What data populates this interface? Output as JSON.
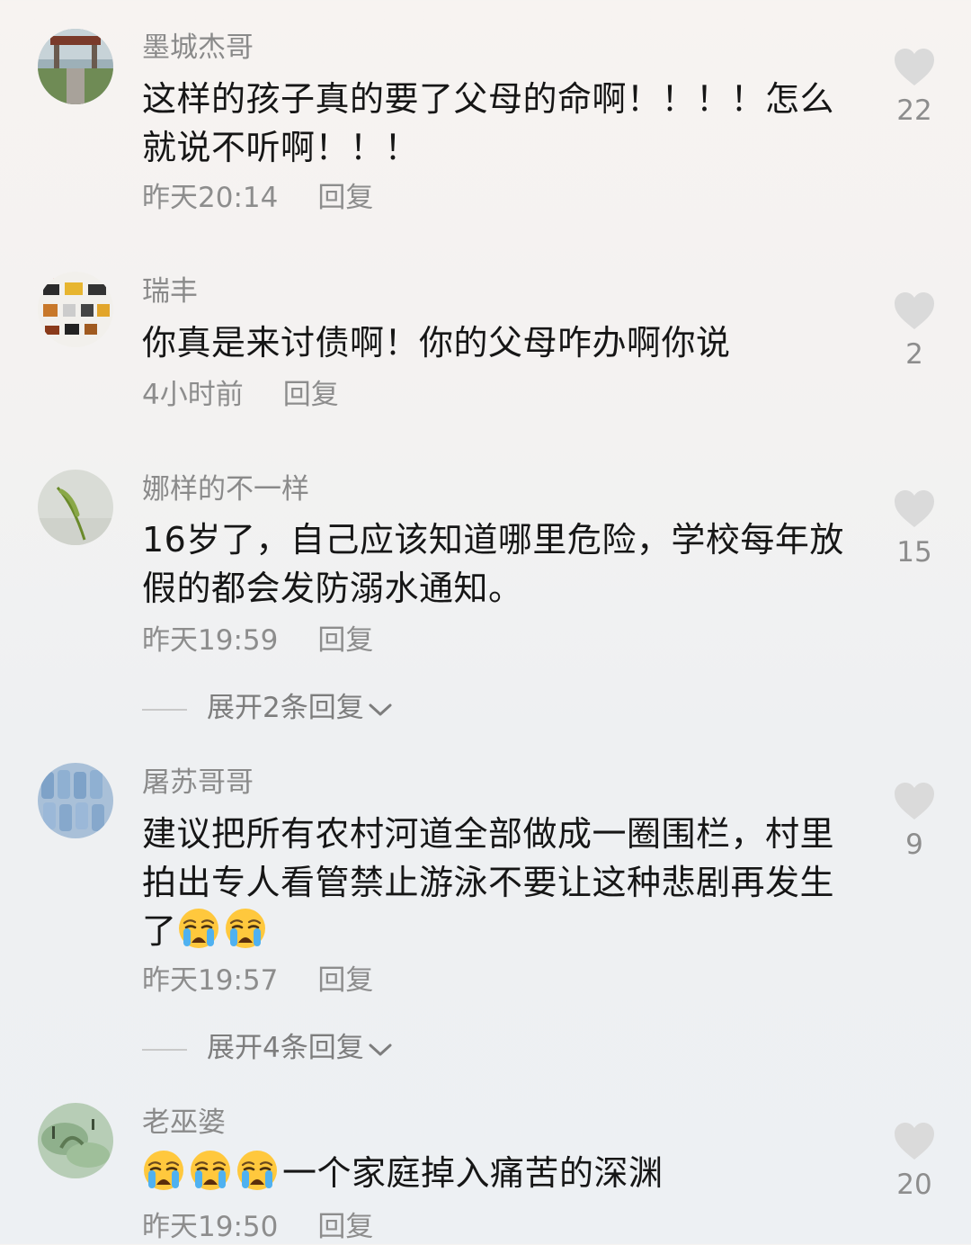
{
  "comments": [
    {
      "username": "墨城杰哥",
      "text": "这样的孩子真的要了父母的命啊！！！！怎么就说不听啊！！！",
      "time": "昨天20:14",
      "reply": "回复",
      "likes": "22"
    },
    {
      "username": "瑞丰",
      "text": "你真是来讨债啊！你的父母咋办啊你说",
      "time": "4小时前",
      "reply": "回复",
      "likes": "2"
    },
    {
      "username": "娜样的不一样",
      "text": "16岁了，自己应该知道哪里危险，学校每年放假的都会发防溺水通知。",
      "time": "昨天19:59",
      "reply": "回复",
      "likes": "15",
      "expand": "展开2条回复"
    },
    {
      "username": "屠苏哥哥",
      "text_line1": "建议把所有农村河道全部做成一圈围栏，村里拍出专人看管禁止游泳不要让这种悲剧再发生",
      "text_tail": "了",
      "time": "昨天19:57",
      "reply": "回复",
      "likes": "9",
      "expand": "展开4条回复"
    },
    {
      "username": "老巫婆",
      "text": "一个家庭掉入痛苦的深渊",
      "time": "昨天19:50",
      "reply": "回复",
      "likes": "20"
    }
  ],
  "icons": {
    "like": "heart-icon",
    "emoji": "loudly-crying-face-emoji",
    "expand": "chevron-down-icon"
  },
  "colors": {
    "meta": "#8d8d8d",
    "heart": "#dadada",
    "text": "#161616"
  }
}
